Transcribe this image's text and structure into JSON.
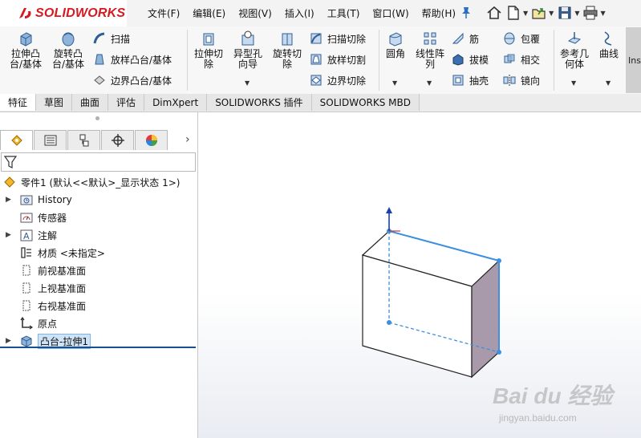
{
  "app": {
    "brand": "SOLIDWORKS",
    "brand_color": "#d71920"
  },
  "menu": [
    {
      "label": "文件(F)"
    },
    {
      "label": "编辑(E)"
    },
    {
      "label": "视图(V)"
    },
    {
      "label": "插入(I)"
    },
    {
      "label": "工具(T)"
    },
    {
      "label": "窗口(W)"
    },
    {
      "label": "帮助(H)"
    }
  ],
  "quick_access": [
    {
      "icon": "home-icon"
    },
    {
      "icon": "new-document-icon"
    },
    {
      "icon": "open-folder-icon"
    },
    {
      "icon": "save-icon"
    },
    {
      "icon": "print-icon"
    }
  ],
  "ribbon": {
    "extrude_boss": "拉伸凸\n台/基体",
    "revolve_boss": "旋转凸\n台/基体",
    "sweep": "扫描",
    "loft_boss": "放样凸台/基体",
    "boundary_boss": "边界凸台/基体",
    "extrude_cut": "拉伸切\n除",
    "hole_wizard": "异型孔\n向导",
    "revolve_cut": "旋转切\n除",
    "swept_cut": "扫描切除",
    "lofted_cut": "放样切割",
    "boundary_cut": "边界切除",
    "fillet": "圆角",
    "linear_pattern": "线性阵\n列",
    "rib": "筋",
    "draft": "拔模",
    "shell": "抽壳",
    "wrap": "包覆",
    "intersect": "相交",
    "mirror": "镜向",
    "ref_geometry": "参考几\n何体",
    "curves": "曲线",
    "ins_label": "Ins"
  },
  "tabs": [
    {
      "label": "特征",
      "active": true
    },
    {
      "label": "草图"
    },
    {
      "label": "曲面"
    },
    {
      "label": "评估"
    },
    {
      "label": "DimXpert"
    },
    {
      "label": "SOLIDWORKS 插件"
    },
    {
      "label": "SOLIDWORKS MBD"
    }
  ],
  "feature_tree": {
    "root": "零件1  (默认<<默认>_显示状态 1>)",
    "items": [
      {
        "label": "History",
        "icon": "history-folder-icon",
        "expandable": true
      },
      {
        "label": "传感器",
        "icon": "sensor-icon",
        "expandable": false
      },
      {
        "label": "注解",
        "icon": "annotation-icon",
        "expandable": true
      },
      {
        "label": "材质 <未指定>",
        "icon": "material-icon",
        "expandable": false
      },
      {
        "label": "前视基准面",
        "icon": "plane-icon",
        "expandable": false
      },
      {
        "label": "上视基准面",
        "icon": "plane-icon",
        "expandable": false
      },
      {
        "label": "右视基准面",
        "icon": "plane-icon",
        "expandable": false
      },
      {
        "label": "原点",
        "icon": "origin-icon",
        "expandable": false
      },
      {
        "label": "凸台-拉伸1",
        "icon": "extrude-feature-icon",
        "expandable": true,
        "selected": true
      }
    ]
  },
  "watermark": {
    "line1": "Bai du 经验",
    "line2": "jingyan.baidu.com"
  },
  "colors": {
    "selection_blue": "#3d8fe0",
    "side_face": "#a99aab",
    "origin_arrow": "#1c3fa6"
  }
}
